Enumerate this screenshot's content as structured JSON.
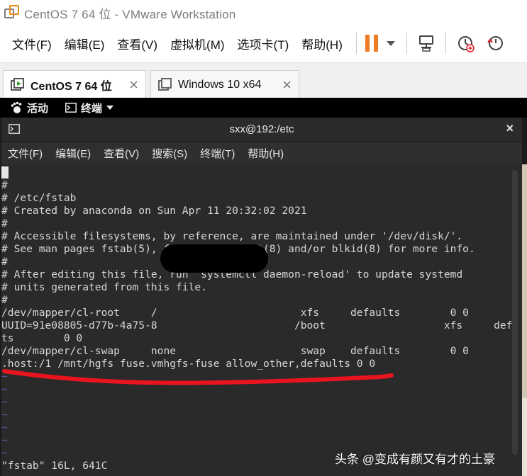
{
  "window": {
    "title": "CentOS 7 64 位 - VMware Workstation",
    "accent": "#ef7c22"
  },
  "vm_menu": {
    "items": [
      "文件(F)",
      "编辑(E)",
      "查看(V)",
      "虚拟机(M)",
      "选项卡(T)",
      "帮助(H)"
    ]
  },
  "toolbar": {
    "icons": [
      "pause-icon",
      "send-ctrl-alt-del-icon",
      "snapshot-icon",
      "revert-snapshot-icon"
    ]
  },
  "tabs": [
    {
      "label": "CentOS 7 64 位",
      "active": true
    },
    {
      "label": "Windows 10 x64",
      "active": false
    }
  ],
  "gnome": {
    "activities": "活动",
    "app_menu": "终端"
  },
  "terminal": {
    "title": "sxx@192:/etc",
    "close": "×",
    "menu": [
      "文件(F)",
      "编辑(E)",
      "查看(V)",
      "搜索(S)",
      "终端(T)",
      "帮助(H)"
    ],
    "lines": [
      "",
      "#",
      "# /etc/fstab",
      "# Created by anaconda on Sun Apr 11 20:32:02 2021",
      "#",
      "# Accessible filesystems, by reference, are maintained under '/dev/disk/'.",
      "# See man pages fstab(5), findfs(8), mount(8) and/or blkid(8) for more info.",
      "#",
      "# After editing this file, run 'systemctl daemon-reload' to update systemd",
      "# units generated from this file.",
      "#",
      "/dev/mapper/cl-root     /                       xfs     defaults        0 0",
      "UUID=91e08805-d77b-4a75-8                      /boot                   xfs     defaul",
      "ts        0 0",
      "/dev/mapper/cl-swap     none                    swap    defaults        0 0",
      ".host:/1 /mnt/hgfs fuse.vmhgfs-fuse allow_other,defaults 0 0",
      "~",
      "~",
      "~",
      "~",
      "~",
      "~",
      "~",
      "\"fstab\" 16L, 641C"
    ]
  },
  "watermark": "头条 @变成有颜又有才的土豪",
  "colors": {
    "annotation_underline": "#e8141f",
    "terminal_bg": "#2a2a2a",
    "tilde": "#5a5aa8"
  }
}
